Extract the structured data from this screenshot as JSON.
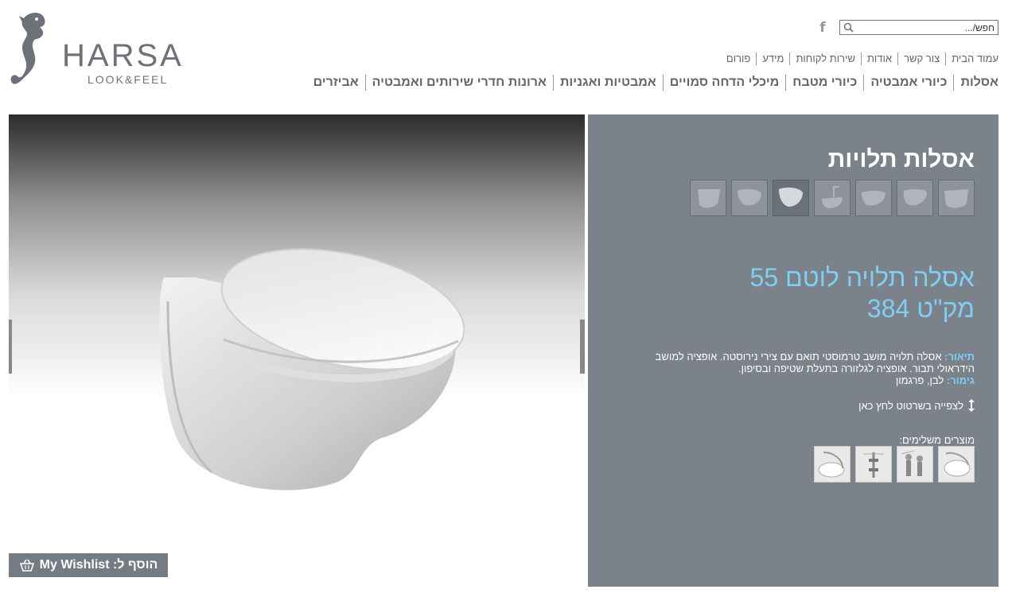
{
  "logo": {
    "brand": "HARSA",
    "tagline": "LOOK&FEEL",
    "icon": "seahorse-icon"
  },
  "search": {
    "placeholder": "חפש/...",
    "icon": "search-icon"
  },
  "social": {
    "facebook_icon": "facebook-icon",
    "facebook_label": "f"
  },
  "top_nav": [
    "עמוד הבית",
    "צור קשר",
    "אודות",
    "שירות לקוחות",
    "מידע",
    "פורום"
  ],
  "main_nav": [
    "אסלות",
    "כיורי אמבטיה",
    "כיורי מטבח",
    "מיכלי הדחה סמויים",
    "אמבטיות ואגניות",
    "ארונות חדרי שירותים ואמבטיה",
    "אביזרים"
  ],
  "wishlist": {
    "label": "הוסף ל: My Wishlist",
    "icon": "basket-icon"
  },
  "product": {
    "category": "אסלות תלויות",
    "name": "אסלה תלויה לוטם 55",
    "sku": "מק\"ט 384",
    "description_label": "תיאור:",
    "description": "אסלה תלויה מושב טרמוסטי תואם עם צירי נירוסטה. אופציה למושב הידראולי תבור. אופציה לגלזורה בתעלת שטיפה ובסיפון.",
    "finish_label": "גימור:",
    "finish": "לבן, פרגמון",
    "drawing_link": "לצפייה בשרטוט לחץ כאן",
    "related_title": "מוצרים משלימים:",
    "active_thumb_index": 4
  },
  "colors": {
    "panel": "#7c828a",
    "accent": "#7ecff4",
    "nav_text": "#666666"
  }
}
